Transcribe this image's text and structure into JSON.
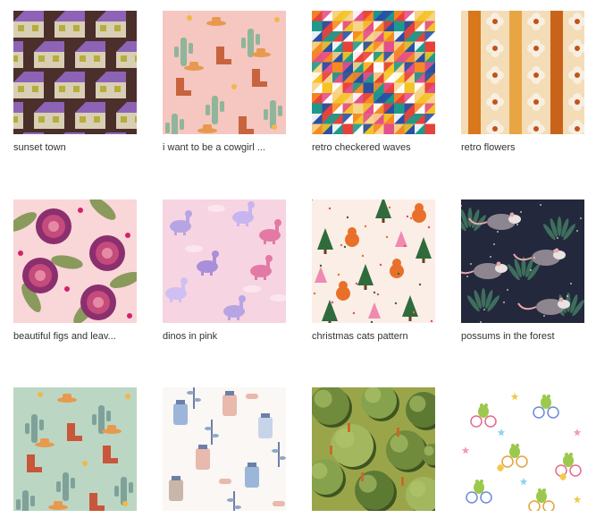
{
  "patterns": [
    {
      "title": "sunset town"
    },
    {
      "title": "i want to be a cowgirl ..."
    },
    {
      "title": "retro checkered waves"
    },
    {
      "title": "retro flowers"
    },
    {
      "title": "beautiful figs and leav..."
    },
    {
      "title": "dinos in pink"
    },
    {
      "title": "christmas cats pattern"
    },
    {
      "title": "possums in the forest"
    },
    {
      "title": ""
    },
    {
      "title": ""
    },
    {
      "title": ""
    },
    {
      "title": ""
    }
  ]
}
